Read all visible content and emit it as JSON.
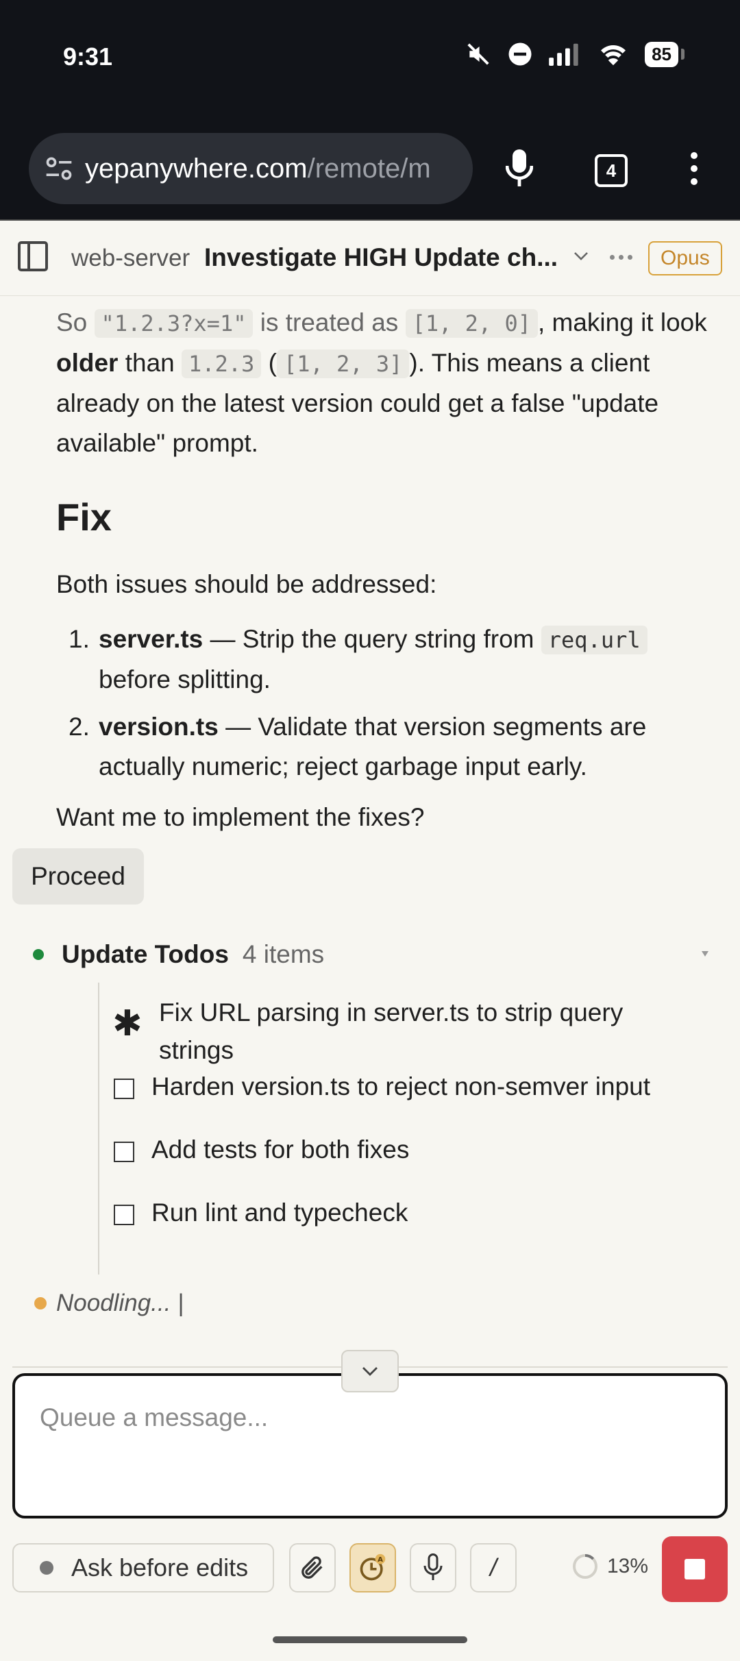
{
  "status_bar": {
    "time": "9:31",
    "battery": "85",
    "icons": [
      "mute-icon",
      "dnd-icon",
      "signal-icon",
      "wifi-icon",
      "battery-icon"
    ]
  },
  "browser": {
    "url_host": "yepanywhere.com",
    "url_path": "/remote/m",
    "tab_count": "4"
  },
  "header": {
    "project": "web-server",
    "title": "Investigate HIGH Update ch...",
    "model": "Opus"
  },
  "message": {
    "p1": {
      "t1": "So ",
      "c1": "\"1.2.3?x=1\"",
      "t2": " is treated as ",
      "c2": "[1, 2, 0]",
      "t3": ", making it look ",
      "b1": "older",
      "t4": " than ",
      "c3": "1.2.3",
      "t5": " (",
      "c4": "[1, 2, 3]",
      "t6": "). This means a client already on the latest version could get a false \"update available\" prompt."
    },
    "heading": "Fix",
    "intro": "Both issues should be addressed:",
    "list": [
      {
        "num": "1.",
        "bold": "server.ts",
        "text1": " — Strip the query string from ",
        "code": "req.url",
        "text2": " before splitting."
      },
      {
        "num": "2.",
        "bold": "version.ts",
        "text1": " — Validate that version segments are actually numeric; reject garbage input early."
      }
    ],
    "question": "Want me to implement the fixes?",
    "proceed_label": "Proceed"
  },
  "todos": {
    "title": "Update Todos",
    "count": "4 items",
    "items": [
      {
        "label": "Fix URL parsing in server.ts to strip query strings",
        "status": "in_progress"
      },
      {
        "label": "Harden version.ts to reject non-semver input",
        "status": "pending"
      },
      {
        "label": "Add tests for both fixes",
        "status": "pending"
      },
      {
        "label": "Run lint and typecheck",
        "status": "pending"
      }
    ]
  },
  "activity": {
    "text": "Noodling... |"
  },
  "composer": {
    "placeholder": "Queue a message..."
  },
  "toolbar": {
    "mode_label": "Ask before edits",
    "slash_label": "/",
    "context_percent": "13%"
  },
  "colors": {
    "accent_model": "#c4862a",
    "stop": "#d9434a",
    "active_todo_dot": "#1f8a3d",
    "activity_dot": "#e7a84b"
  }
}
